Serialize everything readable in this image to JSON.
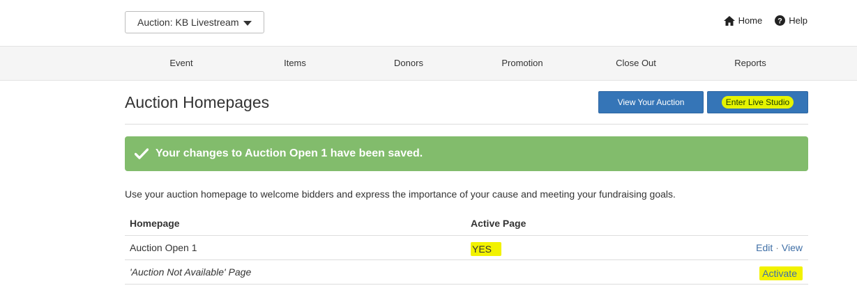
{
  "header": {
    "auction_select": "Auction: KB Livestream",
    "home_label": "Home",
    "help_label": "Help"
  },
  "nav": {
    "items": [
      {
        "label": "Event"
      },
      {
        "label": "Items"
      },
      {
        "label": "Donors"
      },
      {
        "label": "Promotion"
      },
      {
        "label": "Close Out"
      },
      {
        "label": "Reports"
      }
    ]
  },
  "page": {
    "title": "Auction Homepages",
    "view_button": "View Your Auction",
    "live_button": "Enter Live Studio",
    "alert": "Your changes to Auction Open 1 have been saved.",
    "intro": "Use your auction homepage to welcome bidders and express the importance of your cause and meeting your fundraising goals."
  },
  "table": {
    "headers": [
      "Homepage",
      "Active Page"
    ],
    "rows": [
      {
        "homepage": "Auction Open 1",
        "active": "YES",
        "edit": "Edit",
        "sep": "·",
        "view": "View"
      },
      {
        "homepage": "'Auction Not Available' Page",
        "active": "",
        "activate": "Activate"
      }
    ]
  },
  "colors": {
    "primary_button": "#3575b7",
    "alert_success": "#82bc6c",
    "highlight": "#f2f200",
    "link": "#3f6fa6"
  }
}
